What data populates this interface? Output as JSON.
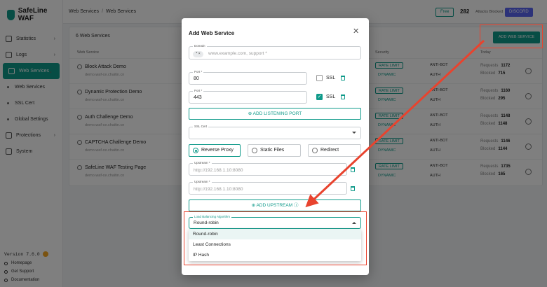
{
  "app": {
    "name": "SafeLine WAF"
  },
  "sidebar": {
    "items": [
      {
        "label": "Statistics"
      },
      {
        "label": "Logs"
      },
      {
        "label": "Web Services"
      },
      {
        "label": "Web Services"
      },
      {
        "label": "SSL Cert"
      },
      {
        "label": "Global Settings"
      },
      {
        "label": "Protections"
      },
      {
        "label": "System"
      }
    ],
    "version": "Version 7.6.0",
    "footer": [
      {
        "label": "Homepage"
      },
      {
        "label": "Get Support"
      },
      {
        "label": "Documentation"
      }
    ]
  },
  "topbar": {
    "breadcrumb": [
      "Web Services",
      "Web Services"
    ],
    "plan": "Free",
    "count": "282",
    "count_label": "Attacks Blocked",
    "discord": "DISCORD"
  },
  "list": {
    "title": "6 Web Services",
    "add_button": "ADD WEB SERVICE",
    "columns": [
      "Web Service",
      "Security",
      "Today"
    ],
    "rows": [
      {
        "name": "Block Attack Demo",
        "sub": "demo.waf-ce.chaitin.cn",
        "t1": "RATE LIMIT",
        "t2": "DYNAMIC",
        "t3": "ANTI-BOT",
        "t4": "AUTH",
        "r1": "1172",
        "r2": "715"
      },
      {
        "name": "Dynamic Protection Demo",
        "sub": "demo.waf-ce.chaitin.cn",
        "t1": "RATE LIMIT",
        "t2": "DYNAMIC",
        "t3": "ANTI-BOT",
        "t4": "AUTH",
        "r1": "1160",
        "r2": "295"
      },
      {
        "name": "Auth Challenge Demo",
        "sub": "demo.waf-ce.chaitin.cn",
        "t1": "RATE LIMIT",
        "t2": "DYNAMIC",
        "t3": "ANTI-BOT",
        "t4": "AUTH",
        "r1": "1148",
        "r2": "1148"
      },
      {
        "name": "CAPTCHA Challenge Demo",
        "sub": "demo.waf-ce.chaitin.cn",
        "t1": "RATE LIMIT",
        "t2": "DYNAMIC",
        "t3": "ANTI-BOT",
        "t4": "AUTH",
        "r1": "1146",
        "r2": "1144"
      },
      {
        "name": "SafeLine WAF Testing Page",
        "sub": "demo.waf-ce.chaitin.cn",
        "t1": "RATE LIMIT",
        "t2": "DYNAMIC",
        "t3": "ANTI-BOT",
        "t4": "AUTH",
        "r1": "1735",
        "r2": "165"
      }
    ],
    "stat_labels": [
      "Requests",
      "Blocked"
    ]
  },
  "modal": {
    "title": "Add Web Service",
    "domain": {
      "label": "Domain",
      "chip": "*",
      "placeholder": "www.example.com, support *"
    },
    "ports": [
      {
        "label": "Port *",
        "value": "80",
        "ssl": "SSL"
      },
      {
        "label": "Port *",
        "value": "443",
        "ssl": "SSL"
      }
    ],
    "add_port": "ADD LISTENING PORT",
    "ssl_cert": {
      "label": "SSL Cert"
    },
    "modes": [
      "Reverse Proxy",
      "Static Files",
      "Redirect"
    ],
    "upstreams": [
      {
        "label": "Upstream *",
        "placeholder": "http://192.168.1.10:8080"
      },
      {
        "label": "Upstream *",
        "placeholder": "http://192.168.1.10:8080"
      }
    ],
    "add_upstream": "ADD UPSTREAM",
    "lb": {
      "label": "Load Balancing Algorithm",
      "value": "Round-robin",
      "options": [
        "Round-robin",
        "Least Connections",
        "IP Hash"
      ]
    }
  },
  "colors": {
    "brand": "#0f9a8a",
    "annotation": "#e8432e"
  }
}
